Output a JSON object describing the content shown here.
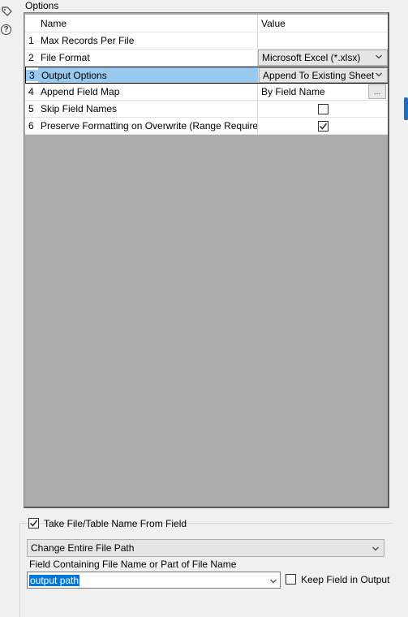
{
  "options": {
    "section_label": "Options"
  },
  "grid": {
    "headers": {
      "name": "Name",
      "value": "Value"
    },
    "rows": [
      {
        "num": "1",
        "name": "Max Records Per File",
        "value": ""
      },
      {
        "num": "2",
        "name": "File Format",
        "value": "Microsoft Excel (*.xlsx)"
      },
      {
        "num": "3",
        "name": "Output Options",
        "value": "Append To Existing Sheet"
      },
      {
        "num": "4",
        "name": "Append Field Map",
        "value": "By Field Name",
        "button": "..."
      },
      {
        "num": "5",
        "name": "Skip Field Names",
        "checked": false
      },
      {
        "num": "6",
        "name": "Preserve Formatting on Overwrite (Range Required)",
        "checked": true
      }
    ]
  },
  "bottom": {
    "take_file_label": "Take File/Table Name From Field",
    "take_file_checked": true,
    "change_option": "Change Entire File Path",
    "field_label": "Field Containing File Name or Part of File Name",
    "field_value": "output path",
    "keep_field_label": "Keep Field in Output",
    "keep_field_checked": false
  },
  "icons": {
    "tag": "tag-icon",
    "help": "help-icon",
    "dropdown": "chevron-down-icon",
    "check": "check-icon"
  }
}
